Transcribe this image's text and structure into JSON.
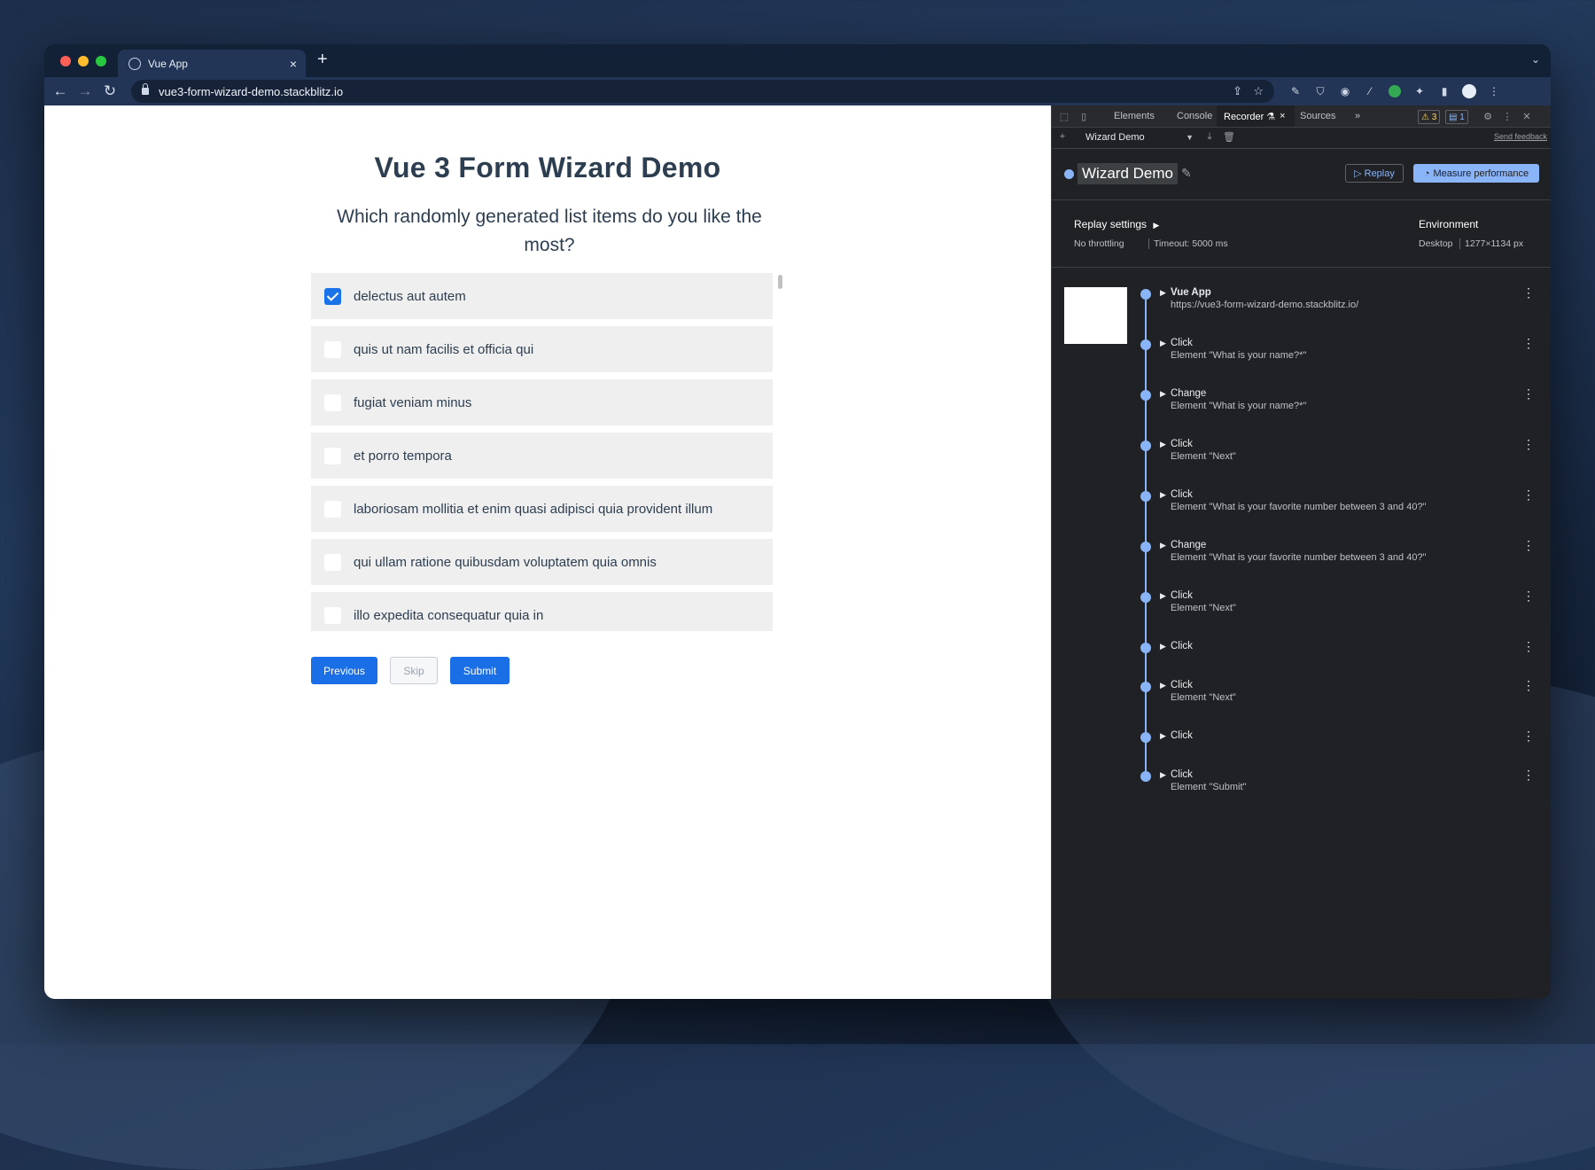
{
  "browser": {
    "tab_title": "Vue App",
    "tab_close": "×",
    "new_tab": "+",
    "tab_menu": "⌄",
    "url": "vue3-form-wizard-demo.stackblitz.io"
  },
  "page": {
    "title": "Vue 3 Form Wizard Demo",
    "question": "Which randomly generated list items do you like the most?",
    "items": [
      {
        "label": "delectus aut autem",
        "checked": true
      },
      {
        "label": "quis ut nam facilis et officia qui",
        "checked": false
      },
      {
        "label": "fugiat veniam minus",
        "checked": false
      },
      {
        "label": "et porro tempora",
        "checked": false
      },
      {
        "label": "laboriosam mollitia et enim quasi adipisci quia provident illum",
        "checked": false
      },
      {
        "label": "qui ullam ratione quibusdam voluptatem quia omnis",
        "checked": false
      },
      {
        "label": "illo expedita consequatur quia in",
        "checked": false
      }
    ],
    "buttons": {
      "previous": "Previous",
      "skip": "Skip",
      "submit": "Submit"
    }
  },
  "devtools": {
    "tabs": {
      "elements": "Elements",
      "console": "Console",
      "recorder": "Recorder ⚗",
      "recorder_close": "×",
      "sources": "Sources",
      "more": "»"
    },
    "badges": {
      "warnings": "⚠ 3",
      "messages": "▤ 1"
    },
    "recording_select": "Wizard Demo",
    "send_feedback": "Send feedback",
    "recording_title": "Wizard Demo",
    "replay_button": "▷ Replay",
    "measure_button": "Measure performance",
    "replay_settings": {
      "label": "Replay settings",
      "throttling": "No throttling",
      "timeout": "Timeout: 5000 ms"
    },
    "environment": {
      "label": "Environment",
      "device": "Desktop",
      "size": "1277×1134 px"
    },
    "steps": [
      {
        "title": "Vue App",
        "detail": "https://vue3-form-wizard-demo.stackblitz.io/",
        "bold": true
      },
      {
        "title": "Click",
        "detail": "Element \"What is your name?*\""
      },
      {
        "title": "Change",
        "detail": "Element \"What is your name?*\""
      },
      {
        "title": "Click",
        "detail": "Element \"Next\""
      },
      {
        "title": "Click",
        "detail": "Element \"What is your favorite number between 3 and 40?\""
      },
      {
        "title": "Change",
        "detail": "Element \"What is your favorite number between 3 and 40?\""
      },
      {
        "title": "Click",
        "detail": "Element \"Next\""
      },
      {
        "title": "Click",
        "detail": ""
      },
      {
        "title": "Click",
        "detail": "Element \"Next\""
      },
      {
        "title": "Click",
        "detail": ""
      },
      {
        "title": "Click",
        "detail": "Element \"Submit\""
      }
    ]
  },
  "colors": {
    "accent": "#1a6fe6",
    "devtools_accent": "#8ab4f8",
    "title_text": "#2d3e50"
  }
}
